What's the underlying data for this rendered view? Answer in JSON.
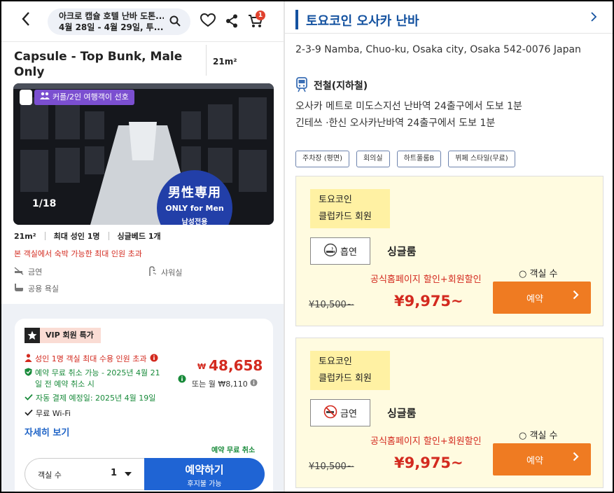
{
  "left": {
    "search": {
      "line1": "아크로 캡슐 호텔 난바 도톤...",
      "line2": "4월 28일 - 4월 29일, 투..."
    },
    "cart_count": "1",
    "room": {
      "title": "Capsule - Top Bunk, Male Only",
      "area": "21m²"
    },
    "photo": {
      "couple_badge": "커플/2인 여행객이 선호",
      "counter": "1/18",
      "sign_big": "男性専用",
      "sign_small": "ONLY for Men",
      "sign_tiny": "남성전용"
    },
    "specs": [
      "21m²",
      "최대 성인 1명",
      "싱글베드 1개"
    ],
    "warning": "본 객실에서 숙박 가능한 최대 인원 초과",
    "amenities": {
      "smoking": "금연",
      "shower": "샤워실",
      "bath": "공용 욕실"
    },
    "vip": {
      "badge": "VIP 회원 특가",
      "capacity": "성인 1명 객실 최대 수용 인원 초과",
      "cancel_line1": "예약 무료 취소 가능 - 2025년 4월 21",
      "cancel_line2": "일 전 예약 취소 시",
      "autopay": "자동 결제 예정일: 2025년 4월 19일",
      "wifi": "무료 Wi-Fi",
      "currency": "₩",
      "price": "48,658",
      "monthly": "또는 월 ₩8,110",
      "detail_link": "자세히 보기",
      "free_cancel": "예약 무료 취소",
      "rooms_label": "객실 수",
      "rooms_value": "1",
      "book_title": "예약하기",
      "book_sub": "후지불 가능"
    }
  },
  "right": {
    "title": "토요코인 오사카 난바",
    "address": "2-3-9 Namba, Chuo-ku, Osaka city, Osaka 542-0076 Japan",
    "transit_header": "전철(지하철)",
    "transit": [
      "오사카 메트로 미도스지선 난바역 24출구에서 도보 1분",
      "긴테쓰 ·한신 오사카난바역 24출구에서 도보 1분"
    ],
    "tags": [
      "주차장 (평면)",
      "회의실",
      "하트풀룸B",
      "뷔페 스타일(무료)"
    ],
    "plans": [
      {
        "member_l1": "토요코인",
        "member_l2": "클럽카드 회원",
        "smoking": "흡연",
        "room_type": "싱글룸",
        "room_count": "○ 객실 수",
        "discount": "공식홈페이지 할인+회원할인",
        "orig_price": "¥10,500~",
        "price": "¥9,975~",
        "reserve": "예약"
      },
      {
        "member_l1": "토요코인",
        "member_l2": "클럽카드 회원",
        "smoking": "금연",
        "room_type": "싱글룸",
        "room_count": "○ 객실 수",
        "discount": "공식홈페이지 할인+회원할인",
        "orig_price": "¥10,500~",
        "price": "¥9,975~",
        "reserve": "예약"
      }
    ]
  },
  "colors": {
    "accent_blue": "#1f64d4",
    "brand_navy": "#1452a0",
    "sale_red": "#d32a1f",
    "reserve_orange": "#ef7b22",
    "member_yellow": "#fff1a3"
  }
}
